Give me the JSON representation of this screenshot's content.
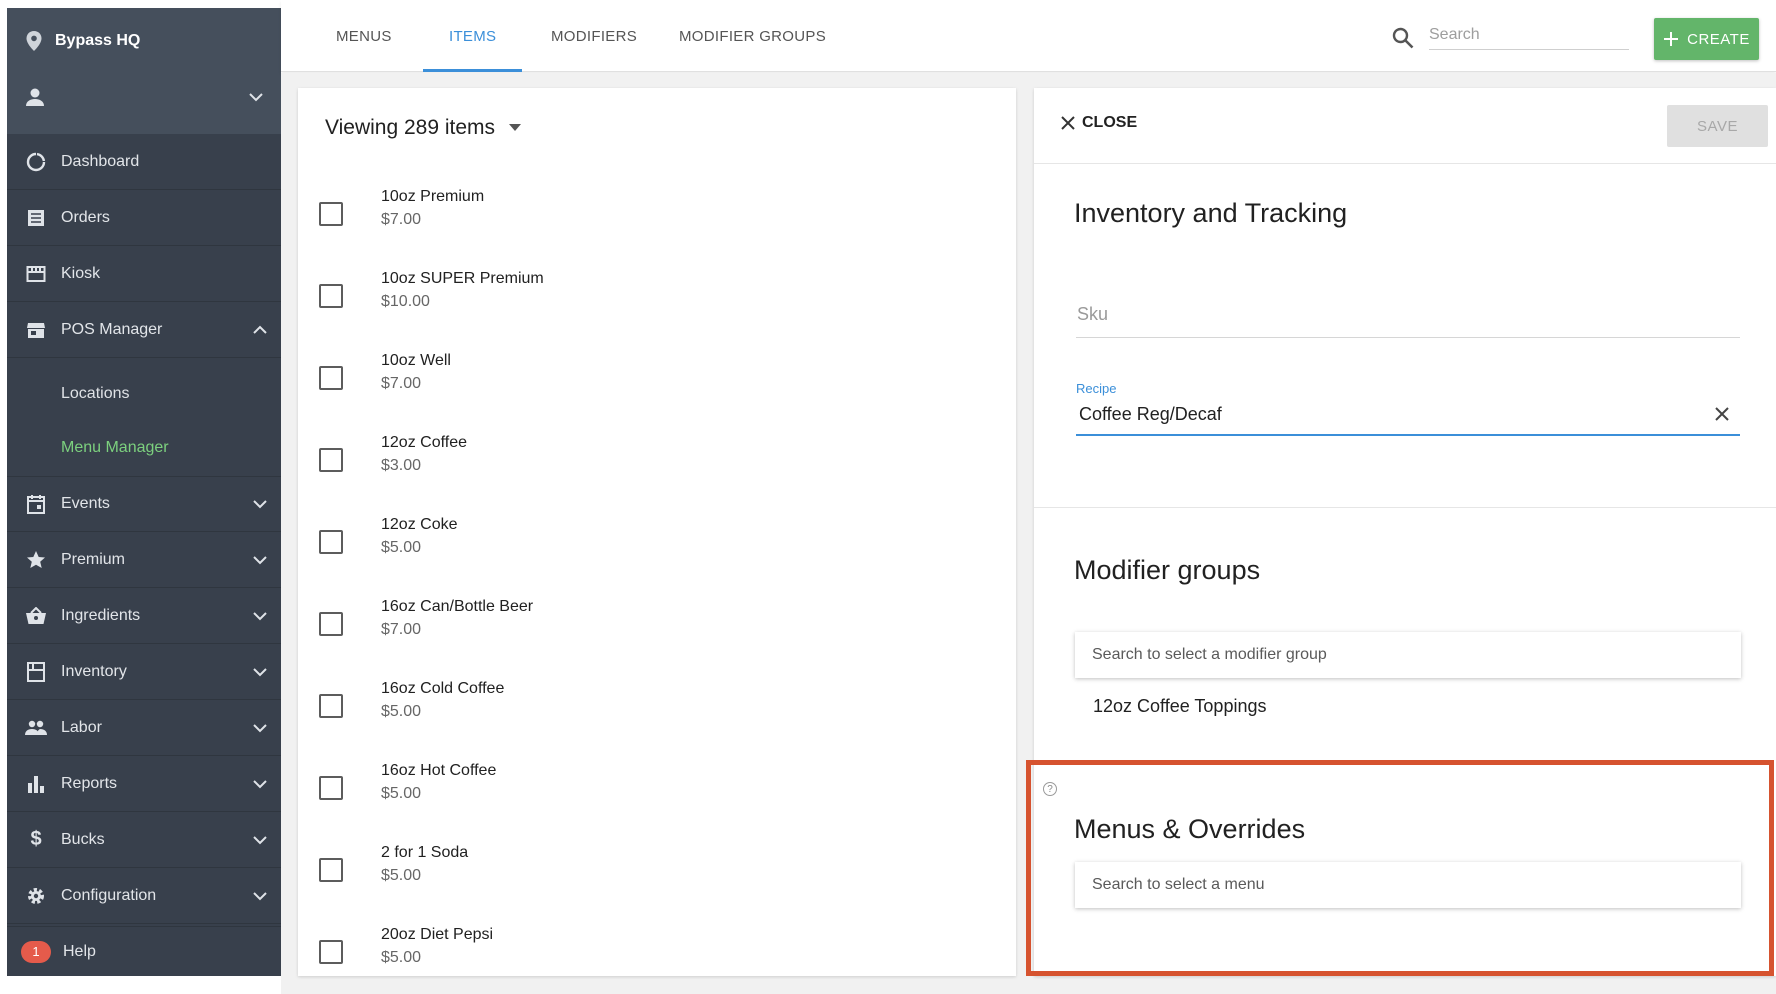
{
  "sidebar": {
    "location": "Bypass HQ",
    "items": [
      {
        "label": "Dashboard",
        "icon": "dashboard-icon"
      },
      {
        "label": "Orders",
        "icon": "orders-icon"
      },
      {
        "label": "Kiosk",
        "icon": "kiosk-icon"
      },
      {
        "label": "POS Manager",
        "icon": "store-icon"
      },
      {
        "label": "Events",
        "icon": "calendar-icon"
      },
      {
        "label": "Premium",
        "icon": "star-icon"
      },
      {
        "label": "Ingredients",
        "icon": "basket-icon"
      },
      {
        "label": "Inventory",
        "icon": "inventory-icon"
      },
      {
        "label": "Labor",
        "icon": "people-icon"
      },
      {
        "label": "Reports",
        "icon": "bar-chart-icon"
      },
      {
        "label": "Bucks",
        "icon": "dollar-icon"
      },
      {
        "label": "Configuration",
        "icon": "gear-icon"
      }
    ],
    "sub_items": [
      "Locations",
      "Menu Manager"
    ],
    "help": {
      "label": "Help",
      "badge": "1"
    }
  },
  "tabs": [
    "MENUS",
    "ITEMS",
    "MODIFIERS",
    "MODIFIER GROUPS"
  ],
  "search": {
    "placeholder": "Search"
  },
  "create_label": "CREATE",
  "list": {
    "viewing": "Viewing 289 items",
    "items": [
      {
        "name": "10oz Premium",
        "price": "$7.00"
      },
      {
        "name": "10oz SUPER Premium",
        "price": "$10.00"
      },
      {
        "name": "10oz Well",
        "price": "$7.00"
      },
      {
        "name": "12oz Coffee",
        "price": "$3.00"
      },
      {
        "name": "12oz Coke",
        "price": "$5.00"
      },
      {
        "name": "16oz Can/Bottle Beer",
        "price": "$7.00"
      },
      {
        "name": "16oz Cold Coffee",
        "price": "$5.00"
      },
      {
        "name": "16oz Hot Coffee",
        "price": "$5.00"
      },
      {
        "name": "2 for 1 Soda",
        "price": "$5.00"
      },
      {
        "name": "20oz Diet Pepsi",
        "price": "$5.00"
      }
    ]
  },
  "detail": {
    "close_label": "CLOSE",
    "save_label": "SAVE",
    "inventory_title": "Inventory and Tracking",
    "sku_placeholder": "Sku",
    "recipe_label": "Recipe",
    "recipe_value": "Coffee Reg/Decaf",
    "modifier_groups_title": "Modifier groups",
    "modifier_search_placeholder": "Search to select a modifier group",
    "modifier_group_item": "12oz Coffee Toppings",
    "help_glyph": "?",
    "menus_title": "Menus & Overrides",
    "menu_search_placeholder": "Search to select a menu"
  },
  "colors": {
    "sidebar_bg": "#38404c",
    "accent_blue": "#3b8fd9",
    "create_green": "#63b56a",
    "active_green": "#7cd07e",
    "highlight_red": "#d6532f",
    "badge_red": "#e55b4b"
  }
}
